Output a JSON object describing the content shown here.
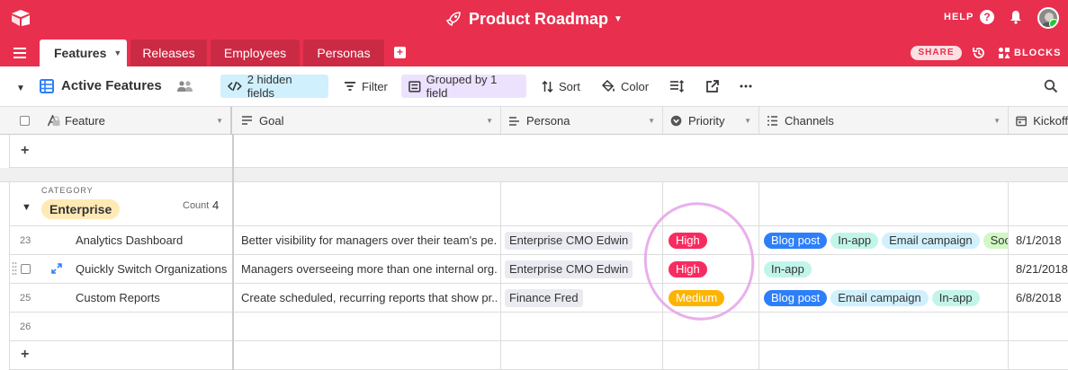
{
  "topbar": {
    "base_title": "Product Roadmap",
    "help_label": "HELP",
    "help_icon_text": "?",
    "share_label": "SHARE",
    "blocks_label": "BLOCKS",
    "add_tab_text": "+",
    "accent": "#e8304e"
  },
  "tabs": [
    {
      "label": "Features",
      "active": true
    },
    {
      "label": "Releases"
    },
    {
      "label": "Employees"
    },
    {
      "label": "Personas"
    }
  ],
  "viewbar": {
    "view_name": "Active Features",
    "hidden_fields": "2 hidden fields",
    "filter": "Filter",
    "grouped": "Grouped by 1 field",
    "sort": "Sort",
    "color": "Color"
  },
  "columns": [
    {
      "label": "Feature",
      "icon": "text-icon"
    },
    {
      "label": "Goal",
      "icon": "long-text-icon"
    },
    {
      "label": "Persona",
      "icon": "link-icon"
    },
    {
      "label": "Priority",
      "icon": "single-select-icon"
    },
    {
      "label": "Channels",
      "icon": "multi-select-icon"
    },
    {
      "label": "Kickoff",
      "icon": "date-icon"
    }
  ],
  "group": {
    "label": "CATEGORY",
    "value": "Enterprise",
    "count_label": "Count",
    "count": "4",
    "add_text": "+"
  },
  "rows": [
    {
      "num": "23",
      "feature": "Analytics Dashboard",
      "goal": "Better visibility for managers over their team's pe...",
      "persona": "Enterprise CMO Edwin",
      "priority": "High",
      "channels": [
        "Blog post",
        "In-app",
        "Email campaign",
        "Soci"
      ],
      "kickoff": "8/1/2018"
    },
    {
      "num": "",
      "feature": "Quickly Switch Organizations",
      "goal": "Managers overseeing more than one internal org...",
      "persona": "Enterprise CMO Edwin",
      "priority": "High",
      "channels": [
        "In-app"
      ],
      "kickoff": "8/21/2018"
    },
    {
      "num": "25",
      "feature": "Custom Reports",
      "goal": "Create scheduled, recurring reports that show pr...",
      "persona": "Finance Fred",
      "priority": "Medium",
      "channels": [
        "Blog post",
        "Email campaign",
        "In-app"
      ],
      "kickoff": "6/8/2018"
    },
    {
      "num": "26"
    }
  ],
  "colors": {
    "high": "#f82b60",
    "medium": "#fcb400",
    "blog": "#2d7ff9",
    "inapp": "#c2f5e9",
    "email": "#d0f0fd",
    "social": "#d1f7c4"
  }
}
